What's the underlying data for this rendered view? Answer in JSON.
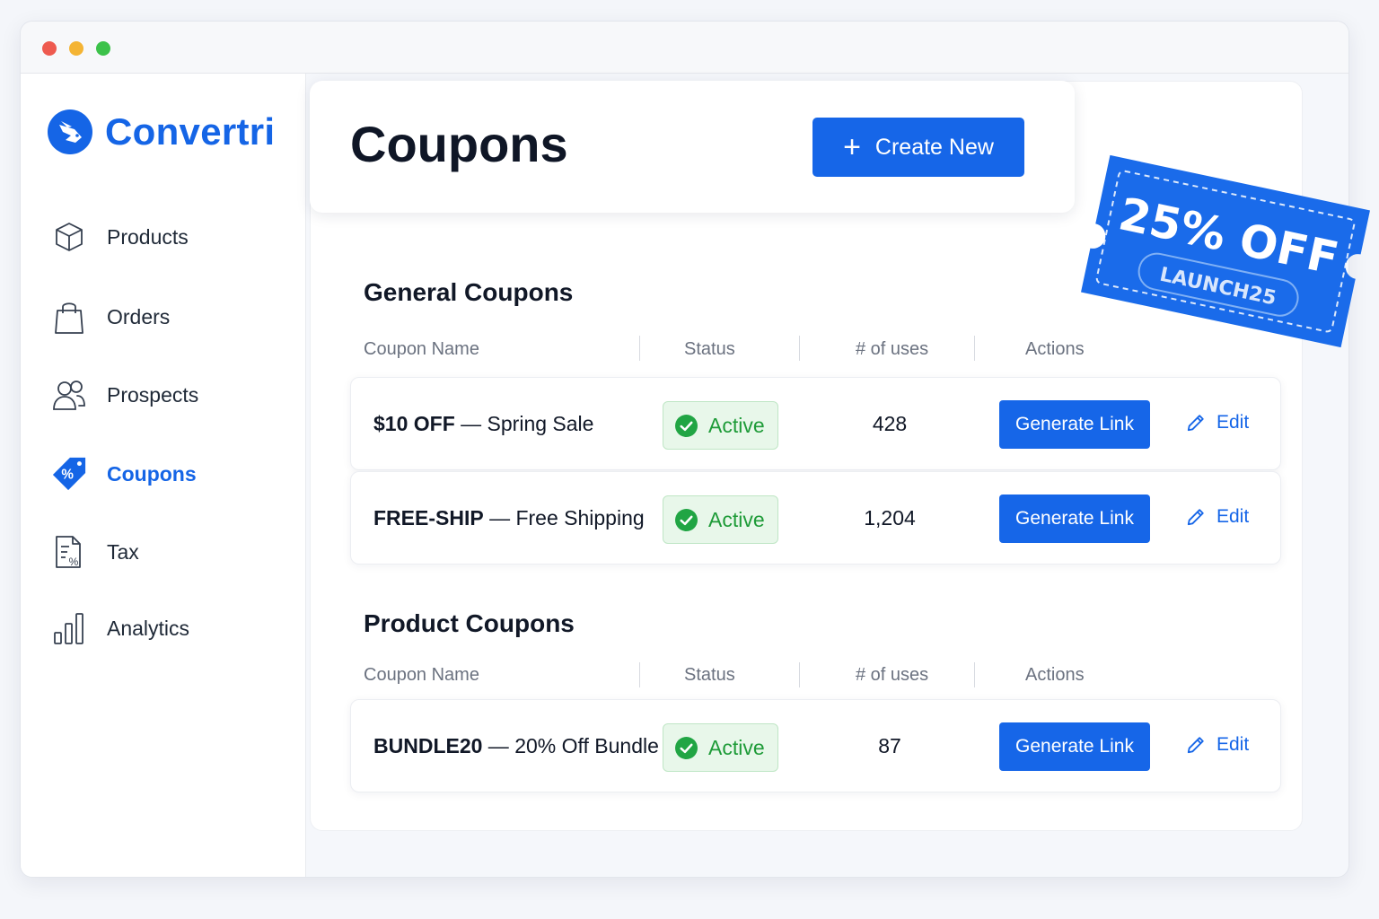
{
  "window": {
    "controls": [
      "close",
      "minimize",
      "maximize"
    ]
  },
  "brand": {
    "name": "Convertri",
    "color": "#1565e6",
    "icon": "rabbit-logo-icon"
  },
  "sidebar": {
    "items": [
      {
        "label": "Products",
        "icon": "box-icon",
        "active": false
      },
      {
        "label": "Orders",
        "icon": "shopping-bag-icon",
        "active": false
      },
      {
        "label": "Prospects",
        "icon": "users-icon",
        "active": false
      },
      {
        "label": "Coupons",
        "icon": "tag-percent-icon",
        "active": true
      },
      {
        "label": "Tax",
        "icon": "tax-document-icon",
        "active": false
      },
      {
        "label": "Analytics",
        "icon": "bar-chart-icon",
        "active": false
      }
    ]
  },
  "header": {
    "title": "Coupons",
    "create_label": "Create New"
  },
  "columns": {
    "name": "Coupon Name",
    "status": "Status",
    "uses": "# of uses",
    "actions": "Actions"
  },
  "general": {
    "title": "General Coupons",
    "rows": [
      {
        "code": "$10 OFF",
        "desc": "Spring Sale",
        "status": "Active",
        "uses": "428",
        "action": "Generate Link",
        "edit": "Edit"
      },
      {
        "code": "FREE-SHIP",
        "desc": "Free Shipping",
        "status": "Active",
        "uses": "1,204",
        "action": "Generate Link",
        "edit": "Edit"
      }
    ]
  },
  "product": {
    "title": "Product Coupons",
    "rows": [
      {
        "code": "BUNDLE20",
        "desc": "20% Off Bundle",
        "status": "Active",
        "uses": "87",
        "action": "Generate Link",
        "edit": "Edit"
      }
    ]
  },
  "ticket": {
    "headline": "25% OFF",
    "code": "LAUNCH25"
  },
  "colors": {
    "accent": "#1666e8",
    "active_green": "#1e9b38",
    "active_bg": "#e8f7ea"
  }
}
